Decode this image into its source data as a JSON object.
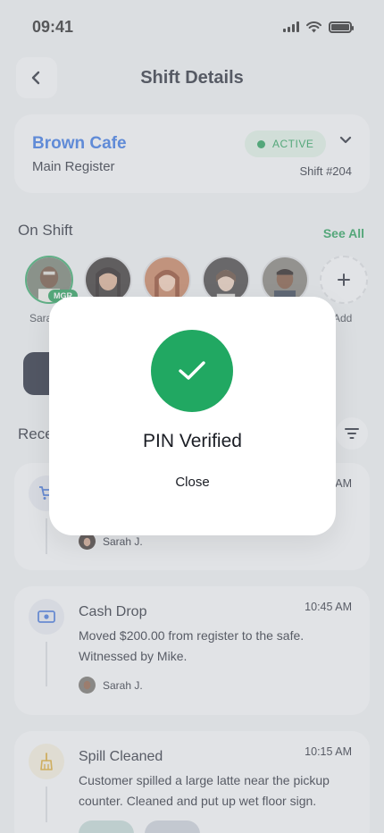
{
  "status_bar": {
    "time": "09:41"
  },
  "header": {
    "title": "Shift Details"
  },
  "location": {
    "name": "Brown Cafe",
    "register": "Main Register",
    "status": "ACTIVE",
    "shift": "Shift #204",
    "accent_color": "#2f6fe0",
    "status_color": "#1d9a52"
  },
  "on_shift": {
    "title": "On Shift",
    "see_all": "See All",
    "manager_badge": "MGR",
    "first_label": "Sara",
    "add_label": "Add"
  },
  "recent": {
    "title": "Rece"
  },
  "activity": [
    {
      "icon": "cart-icon",
      "title": "",
      "time": "AM",
      "description": "",
      "user": "Sarah J."
    },
    {
      "icon": "cash-icon",
      "title": "Cash Drop",
      "time": "10:45 AM",
      "description": "Moved $200.00 from register to the safe. Witnessed by Mike.",
      "user": "Sarah J."
    },
    {
      "icon": "broom-icon",
      "title": "Spill Cleaned",
      "time": "10:15 AM",
      "description": "Customer spilled a large latte near the pickup counter. Cleaned and put up wet floor sign.",
      "user": ""
    }
  ],
  "modal": {
    "title": "PIN Verified",
    "close_label": "Close",
    "success_color": "#21a862"
  }
}
